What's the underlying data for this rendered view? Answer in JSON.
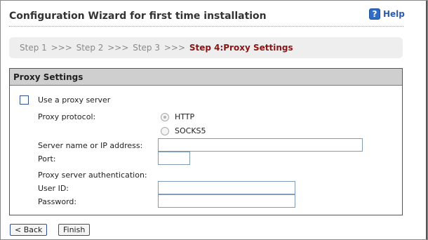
{
  "header": {
    "title": "Configuration Wizard for first time installation",
    "help_label": "Help",
    "help_icon": "question-mark-icon"
  },
  "steps": {
    "step1": "Step 1",
    "sep1": ">>>",
    "step2": "Step 2",
    "sep2": ">>>",
    "step3": "Step 3",
    "sep3": ">>>",
    "current": "Step 4:Proxy Settings"
  },
  "panel": {
    "title": "Proxy Settings",
    "use_proxy_label": "Use a proxy server",
    "use_proxy_checked": false,
    "protocol_label": "Proxy protocol:",
    "protocol_options": [
      "HTTP",
      "SOCKS5"
    ],
    "protocol_selected": "HTTP",
    "server_label": "Server name or IP address:",
    "server_value": "",
    "port_label": "Port:",
    "port_value": "",
    "auth_label": "Proxy server authentication:",
    "userid_label": "User ID:",
    "userid_value": "",
    "password_label": "Password:",
    "password_value": ""
  },
  "buttons": {
    "back": "< Back",
    "finish": "Finish"
  },
  "colors": {
    "current_step": "#8b1414",
    "help_link": "#2a5db0",
    "panel_header_bg": "#cfcfcf"
  }
}
